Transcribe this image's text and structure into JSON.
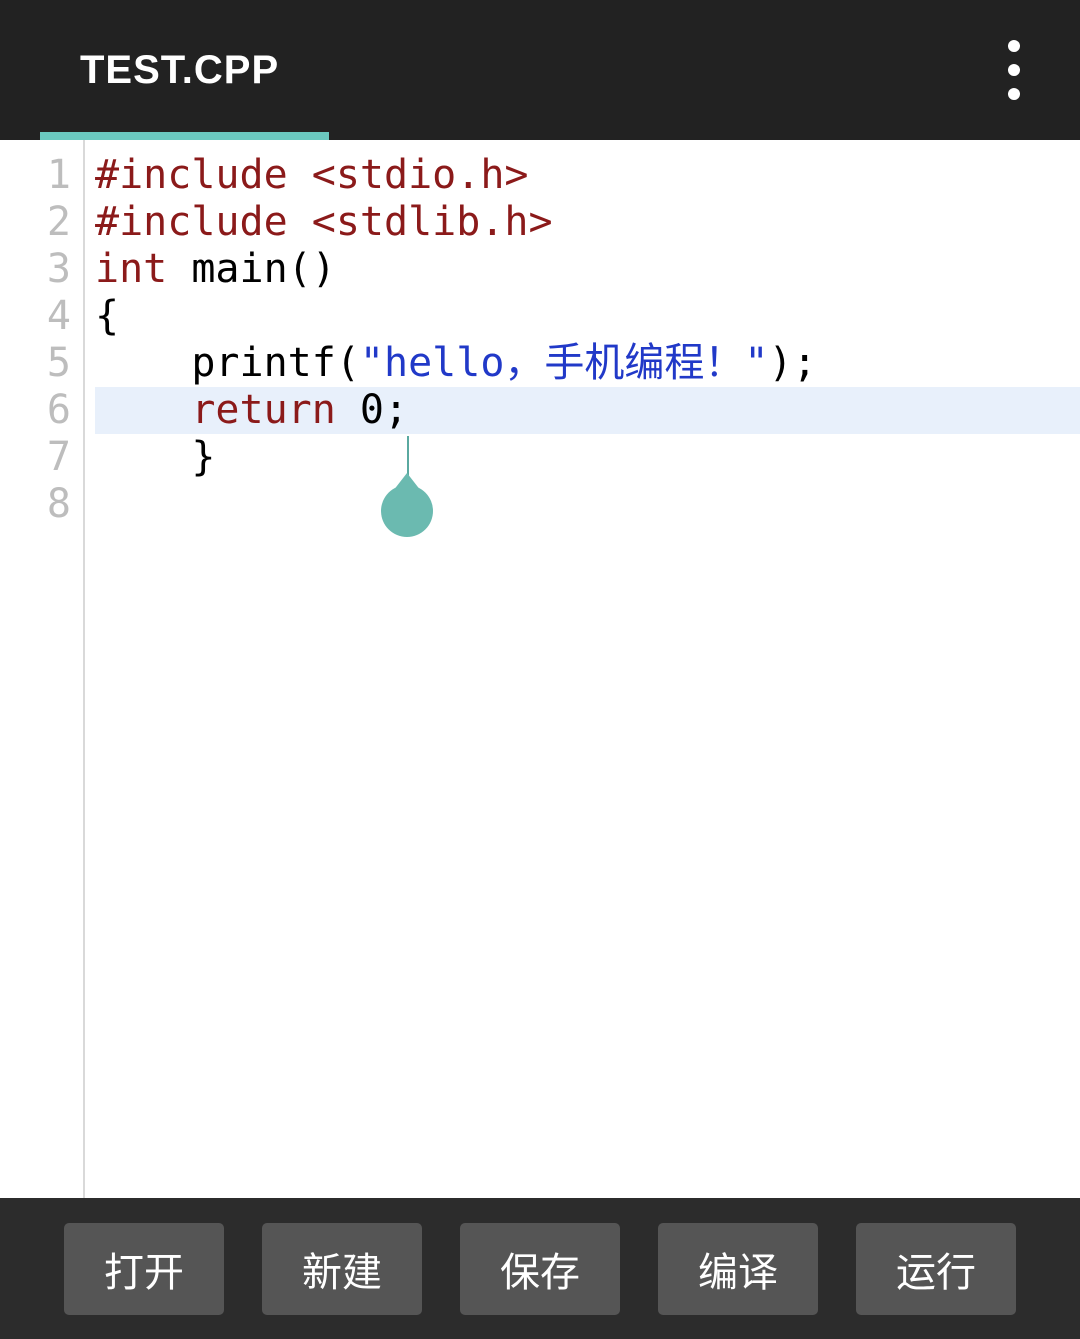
{
  "header": {
    "tab_title": "TEST.CPP",
    "menu_icon": "more-vert"
  },
  "editor": {
    "active_line": 7,
    "cursor_col": 13,
    "line_numbers": [
      "1",
      "2",
      "3",
      "4",
      "5",
      "6",
      "7",
      "8"
    ],
    "lines": [
      {
        "tokens": [
          {
            "t": "#include ",
            "c": "tok-pre"
          },
          {
            "t": "<stdio.h>",
            "c": "tok-pre"
          }
        ]
      },
      {
        "tokens": [
          {
            "t": "#include ",
            "c": "tok-pre"
          },
          {
            "t": "<stdlib.h>",
            "c": "tok-pre"
          }
        ]
      },
      {
        "tokens": [
          {
            "t": "",
            "c": ""
          }
        ]
      },
      {
        "tokens": [
          {
            "t": "int",
            "c": "tok-kw"
          },
          {
            "t": " main()",
            "c": "tok-fn"
          }
        ]
      },
      {
        "tokens": [
          {
            "t": "{",
            "c": "tok-punc"
          }
        ]
      },
      {
        "tokens": [
          {
            "t": "    printf(",
            "c": "tok-fn"
          },
          {
            "t": "\"hello，手机编程！\"",
            "c": "tok-str"
          },
          {
            "t": ");",
            "c": "tok-punc"
          }
        ]
      },
      {
        "tokens": [
          {
            "t": "    ",
            "c": ""
          },
          {
            "t": "return",
            "c": "tok-kw"
          },
          {
            "t": " 0;",
            "c": "tok-num"
          }
        ]
      },
      {
        "tokens": [
          {
            "t": "    }",
            "c": "tok-punc"
          }
        ]
      }
    ]
  },
  "bottom_bar": {
    "buttons": [
      {
        "id": "open",
        "label": "打开"
      },
      {
        "id": "new",
        "label": "新建"
      },
      {
        "id": "save",
        "label": "保存"
      },
      {
        "id": "compile",
        "label": "编译"
      },
      {
        "id": "run",
        "label": "运行"
      }
    ]
  },
  "colors": {
    "header_bg": "#222222",
    "accent": "#6bc9c0",
    "editor_bg": "#ffffff",
    "gutter_fg": "#bdbdbd",
    "active_line_bg": "#e8f0fb",
    "string": "#2139c8",
    "keyword": "#8b1a1a",
    "bottom_bg": "#2c2c2c",
    "button_bg": "#555555"
  }
}
